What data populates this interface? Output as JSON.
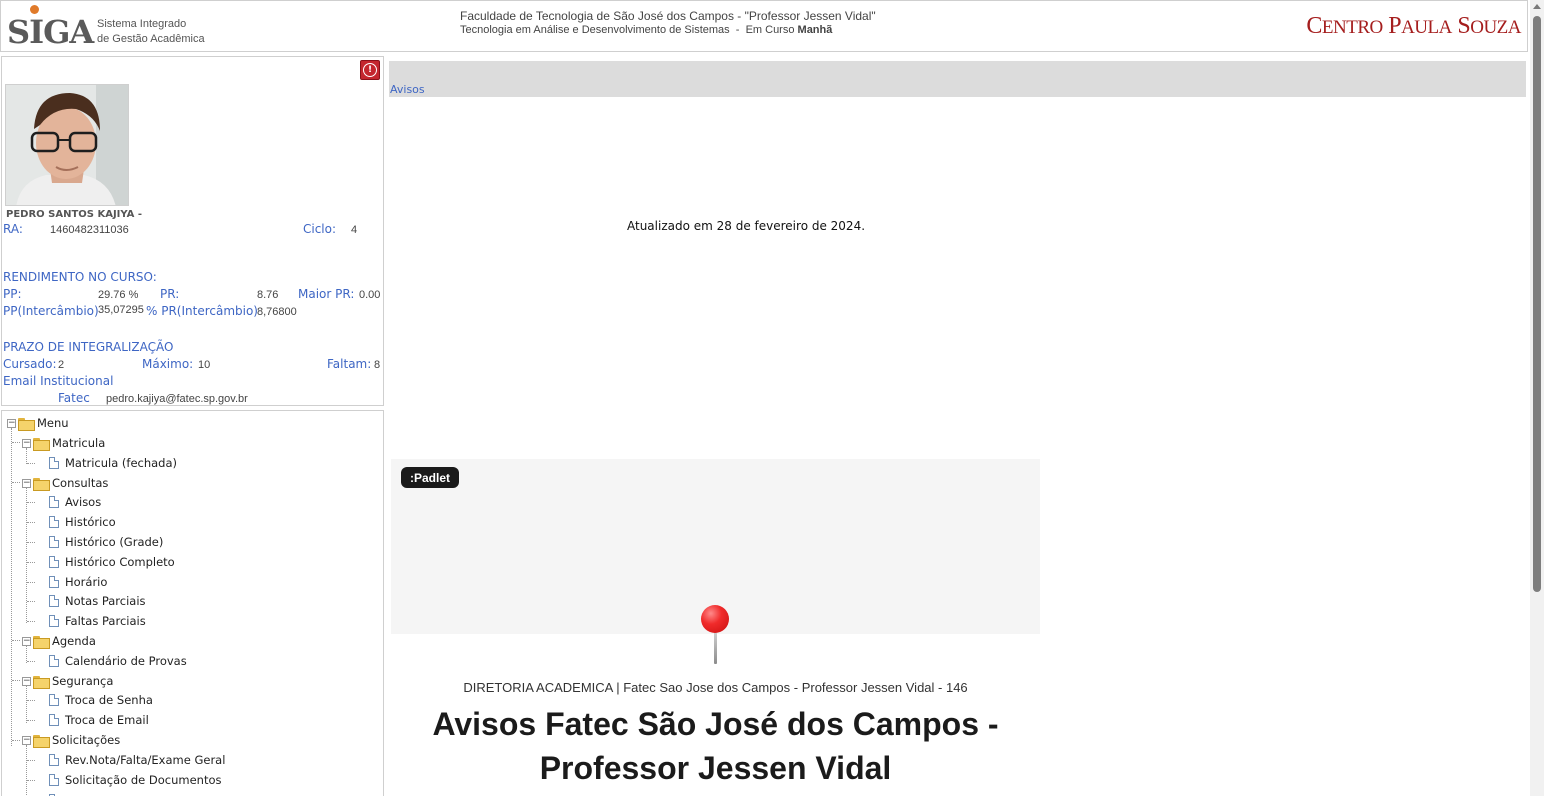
{
  "header": {
    "logo_text": "SIGA",
    "logo_subtitle_line1": "Sistema Integrado",
    "logo_subtitle_line2": "de Gestão Acadêmica",
    "institution": "Faculdade de Tecnologia de São José dos Campos - \"Professor Jessen Vidal\"",
    "course": "Tecnologia em Análise e Desenvolvimento de Sistemas",
    "course_status": "Em Curso",
    "course_shift": "Manhã",
    "cps_logo": "Centro Paula Souza",
    "cps_accent": "#a51e1e"
  },
  "student": {
    "name": "PEDRO SANTOS KAJIYA -",
    "ra_label": "RA:",
    "ra": "1460482311036",
    "ciclo_label": "Ciclo:",
    "ciclo": "4",
    "rendimento_title": "RENDIMENTO NO CURSO:",
    "pp_label": "PP:",
    "pp": "29.76 %",
    "pr_label": "PR:",
    "pr": "8.76",
    "maior_pr_label": "Maior PR:",
    "maior_pr": "0.00",
    "pp_inter_label": "PP(Intercâmbio)",
    "pp_inter": "35,07295",
    "pr_inter_label": "% PR(Intercâmbio)",
    "pr_inter": "8,76800",
    "prazo_title": "PRAZO DE INTEGRALIZAÇÃO",
    "cursado_label": "Cursado:",
    "cursado": "2",
    "maximo_label": "Máximo:",
    "maximo": "10",
    "faltam_label": "Faltam:",
    "faltam": "8",
    "email_title": "Email Institucional",
    "email_label": "Fatec",
    "email": "pedro.kajiya@fatec.sp.gov.br"
  },
  "menu": {
    "root": "Menu",
    "matricula": "Matricula",
    "matricula_fechada": "Matricula (fechada)",
    "consultas": "Consultas",
    "avisos": "Avisos",
    "historico": "Histórico",
    "historico_grade": "Histórico (Grade)",
    "historico_completo": "Histórico Completo",
    "horario": "Horário",
    "notas_parciais": "Notas Parciais",
    "faltas_parciais": "Faltas Parciais",
    "agenda": "Agenda",
    "calendario_provas": "Calendário de Provas",
    "seguranca": "Segurança",
    "troca_senha": "Troca de Senha",
    "troca_email": "Troca de Email",
    "solicitacoes": "Solicitações",
    "rev_nota": "Rev.Nota/Falta/Exame Geral",
    "solicitacao_documentos": "Solicitação de Documentos"
  },
  "main": {
    "avisos_link": "Avisos",
    "updated": "Atualizado em 28 de fevereiro de 2024.",
    "padlet_badge": ":Padlet",
    "board_meta": "DIRETORIA ACADEMICA | Fatec Sao Jose dos Campos - Professor Jessen Vidal - 146",
    "board_title_line1": "Avisos Fatec São José dos Campos -",
    "board_title_line2": "Professor Jessen Vidal"
  },
  "colors": {
    "label_blue": "#3e66c4",
    "alert_red": "#c4262e",
    "pin_red": "#f02b2b"
  }
}
